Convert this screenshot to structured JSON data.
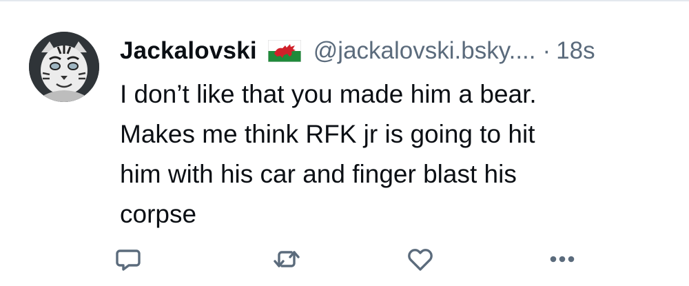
{
  "post": {
    "author": {
      "display_name": "Jackalovski",
      "flag_icon": "wales-flag-icon",
      "handle": "@jackalovski.bsky....",
      "avatar_icon": "avatar-image"
    },
    "separator": "·",
    "timestamp": "18s",
    "text": "I don’t like that you made him a bear.\nMakes me think RFK jr is going to hit\nhim with his car and finger blast his\ncorpse"
  },
  "actions": [
    {
      "name": "reply",
      "icon": "reply-icon"
    },
    {
      "name": "repost",
      "icon": "repost-icon"
    },
    {
      "name": "like",
      "icon": "like-icon"
    },
    {
      "name": "more",
      "icon": "more-icon"
    }
  ],
  "colors": {
    "text": "#0b0f14",
    "muted": "#5b6b7c",
    "divider": "#e3e8ee"
  }
}
